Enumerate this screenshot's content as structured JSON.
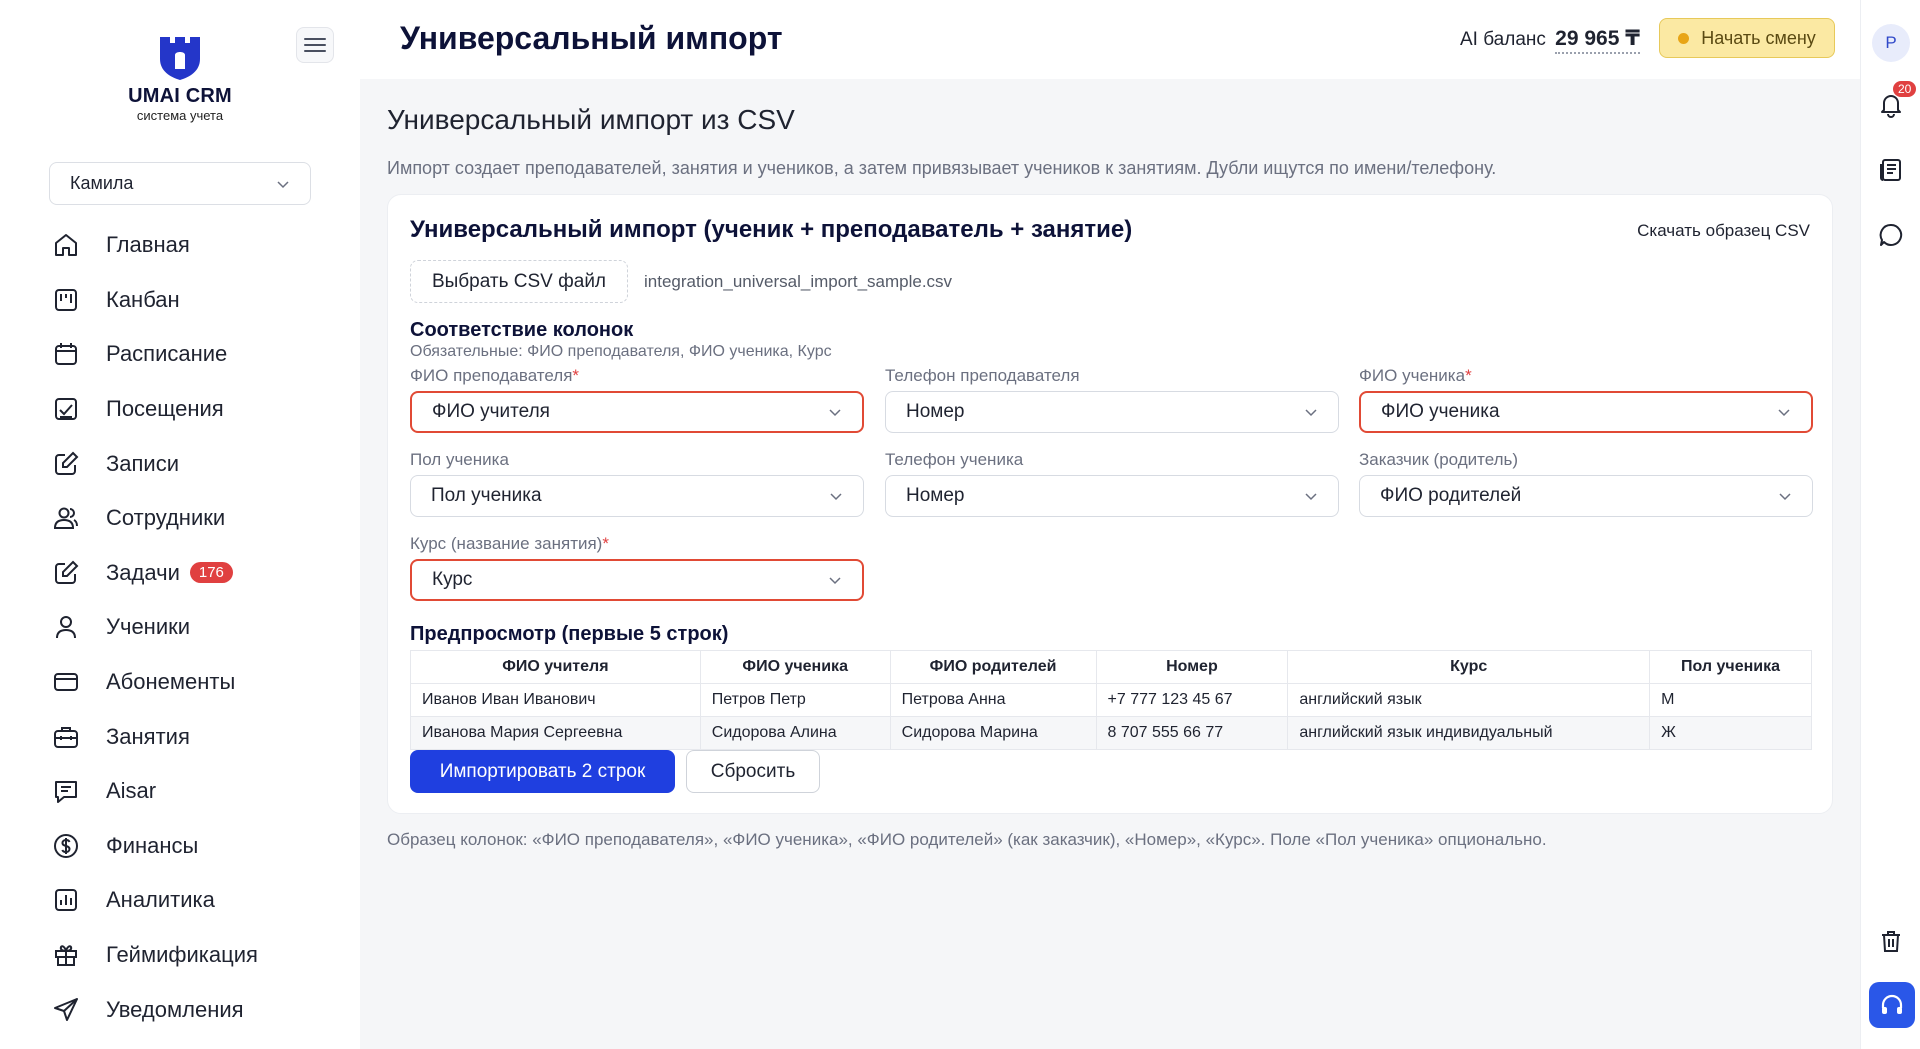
{
  "brand": {
    "name": "UMAI CRM",
    "tagline": "система учета",
    "accent": "#1f3fe0"
  },
  "sidebar": {
    "branch_select": "Камила",
    "items": [
      {
        "label": "Главная",
        "icon": "home-icon"
      },
      {
        "label": "Канбан",
        "icon": "kanban-icon"
      },
      {
        "label": "Расписание",
        "icon": "calendar-icon"
      },
      {
        "label": "Посещения",
        "icon": "attendance-icon"
      },
      {
        "label": "Записи",
        "icon": "edit-icon"
      },
      {
        "label": "Сотрудники",
        "icon": "users-icon"
      },
      {
        "label": "Задачи",
        "icon": "tasks-icon",
        "badge": "176"
      },
      {
        "label": "Ученики",
        "icon": "user-icon"
      },
      {
        "label": "Абонементы",
        "icon": "card-icon"
      },
      {
        "label": "Занятия",
        "icon": "briefcase-icon"
      },
      {
        "label": "Aisar",
        "icon": "chat-icon"
      },
      {
        "label": "Финансы",
        "icon": "dollar-icon"
      },
      {
        "label": "Аналитика",
        "icon": "chart-icon"
      },
      {
        "label": "Геймификация",
        "icon": "gift-icon"
      },
      {
        "label": "Уведомления",
        "icon": "send-icon"
      }
    ]
  },
  "header": {
    "title": "Универсальный импорт",
    "ai_balance_label": "AI баланс",
    "ai_balance_value": "29 965 ₸",
    "start_shift": "Начать смену"
  },
  "rightbar": {
    "avatar": "Р",
    "notifications": "20"
  },
  "main": {
    "section_title": "Универсальный импорт из CSV",
    "section_desc": "Импорт создает преподавателей, занятия и учеников, а затем привязывает учеников к занятиям. Дубли ищутся по имени/телефону.",
    "card": {
      "title": "Универсальный импорт (ученик + преподаватель + занятие)",
      "download_sample": "Скачать образец CSV",
      "choose_file": "Выбрать CSV файл",
      "file_name": "integration_universal_import_sample.csv",
      "mapping_title": "Соответствие колонок",
      "mapping_required": "Обязательные: ФИО преподавателя, ФИО ученика, Курс",
      "fields": [
        {
          "label": "ФИО преподавателя",
          "required": true,
          "value": "ФИО учителя"
        },
        {
          "label": "Телефон преподавателя",
          "required": false,
          "value": "Номер"
        },
        {
          "label": "ФИО ученика",
          "required": true,
          "value": "ФИО ученика"
        },
        {
          "label": "Пол ученика",
          "required": false,
          "value": "Пол ученика"
        },
        {
          "label": "Телефон ученика",
          "required": false,
          "value": "Номер"
        },
        {
          "label": "Заказчик (родитель)",
          "required": false,
          "value": "ФИО родителей"
        },
        {
          "label": "Курс (название занятия)",
          "required": true,
          "value": "Курс"
        }
      ],
      "preview_title": "Предпросмотр (первые 5 строк)",
      "preview_headers": [
        "ФИО учителя",
        "ФИО ученика",
        "ФИО родителей",
        "Номер",
        "Курс",
        "Пол ученика"
      ],
      "preview_rows": [
        [
          "Иванов Иван Иванович",
          "Петров Петр",
          "Петрова Анна",
          "+7 777 123 45 67",
          "английский язык",
          "М"
        ],
        [
          "Иванова Мария Сергеевна",
          "Сидорова Алина",
          "Сидорова Марина",
          "8 707 555 66 77",
          "английский язык индивидуальный",
          "Ж"
        ]
      ],
      "import_button": "Импортировать 2 строк",
      "reset_button": "Сбросить"
    },
    "note": "Образец колонок: «ФИО преподавателя», «ФИО ученика», «ФИО родителей» (как заказчик), «Номер», «Курс». Поле «Пол ученика» опционально."
  }
}
